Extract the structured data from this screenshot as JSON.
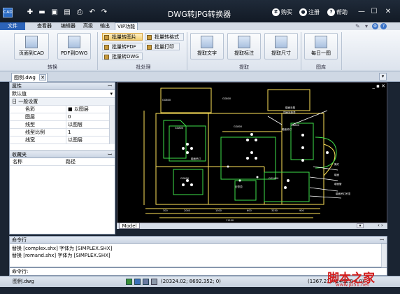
{
  "app": {
    "title": "DWG转JPG转换器",
    "icon_text": "CAD"
  },
  "titlebar": {
    "buy": "购买",
    "register": "注册",
    "help": "帮助"
  },
  "menu": [
    "文件",
    "查看器",
    "编辑器",
    "高级",
    "输出",
    "VIP功能"
  ],
  "ribbon": {
    "convert_group": "转换",
    "convert_buttons": [
      "页面到CAD",
      "PDF到DWG"
    ],
    "batch_group": "批处理",
    "batch_buttons": [
      "批量转图片",
      "批量转PDF",
      "批量转DWG",
      "批量转格式",
      "批量打印"
    ],
    "extract_group": "提取",
    "extract_buttons": [
      "提取文字",
      "提取标注",
      "提取尺寸"
    ],
    "gallery_group": "图库",
    "gallery_buttons": [
      "每日一图"
    ]
  },
  "document_tab": "图例.dwg",
  "properties": {
    "title": "属性",
    "pin": "ꟷ",
    "selector": "默认值",
    "section": "日 一般设置",
    "rows": [
      {
        "key": "色彩",
        "value": "■ 以图层"
      },
      {
        "key": "图层",
        "value": "0"
      },
      {
        "key": "线型",
        "value": "以图层"
      },
      {
        "key": "线型比例",
        "value": "1"
      },
      {
        "key": "线宽",
        "value": "以图层"
      }
    ]
  },
  "favorites": {
    "title": "收藏夹",
    "col_name": "名称",
    "col_path": "路径"
  },
  "drawing": {
    "model_tab": "Model"
  },
  "command": {
    "title": "命令行",
    "lines": [
      "替换 [complex.shx] 字体为 [SIMPLEX.SHX]",
      "替换 [romand.shx] 字体为 [SIMPLEX.SHX]"
    ],
    "input_label": "命令行:"
  },
  "status": {
    "file": "图例.dwg",
    "coords": "(20324.02; 8692.352; 0)",
    "coords2": "(1367.21 x 2462.8 x 0)"
  },
  "watermark": {
    "text": "脚本之家",
    "url": "www.jb51.net"
  },
  "colors": {
    "titlebar": "#121a25",
    "menu_active": "#2c63b8",
    "cad_yellow": "#ffe35a",
    "cad_green": "#3ee04a",
    "cad_white": "#ffffff"
  }
}
